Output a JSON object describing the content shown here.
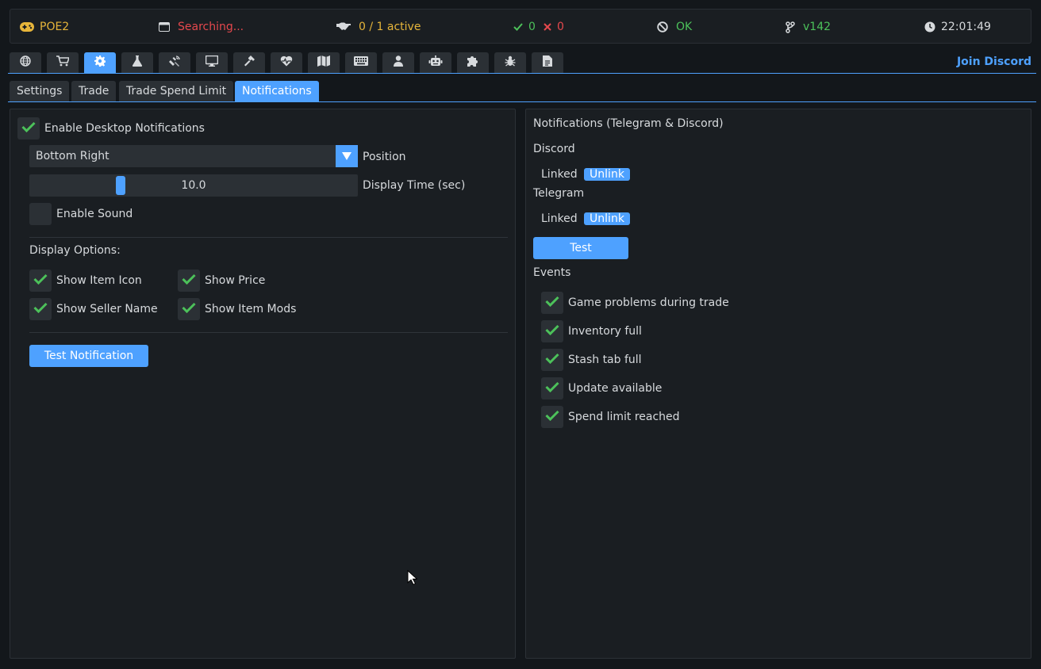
{
  "status": {
    "game": "POE2",
    "search_status": "Searching...",
    "active": "0 / 1 active",
    "success_count": "0",
    "fail_count": "0",
    "connection": "OK",
    "version": "v142",
    "clock": "22:01:49"
  },
  "toolbar": {
    "icons": [
      "globe-icon",
      "cart-icon",
      "gear-icon",
      "flask-icon",
      "satellite-icon",
      "monitor-icon",
      "hammer-icon",
      "heartbeat-icon",
      "map-icon",
      "keyboard-icon",
      "user-icon",
      "robot-icon",
      "puzzle-icon",
      "bug-icon",
      "document-icon"
    ],
    "active_index": 2,
    "join_discord": "Join Discord"
  },
  "subtabs": [
    "Settings",
    "Trade",
    "Trade Spend Limit",
    "Notifications"
  ],
  "active_subtab": "Notifications",
  "desktop": {
    "enable_label": "Enable Desktop Notifications",
    "enabled": true,
    "position_value": "Bottom Right",
    "position_label": "Position",
    "display_time_value": "10.0",
    "display_time_label": "Display Time (sec)",
    "display_time_fraction": 0.27,
    "enable_sound_label": "Enable Sound",
    "sound_enabled": false,
    "display_options_heading": "Display Options:",
    "options": [
      {
        "label": "Show Item Icon",
        "checked": true
      },
      {
        "label": "Show Price",
        "checked": true
      },
      {
        "label": "Show Seller Name",
        "checked": true
      },
      {
        "label": "Show Item Mods",
        "checked": true
      }
    ],
    "test_button": "Test Notification"
  },
  "remote": {
    "heading": "Notifications (Telegram & Discord)",
    "discord_label": "Discord",
    "discord_status": "Linked",
    "discord_unlink": "Unlink",
    "telegram_label": "Telegram",
    "telegram_status": "Linked",
    "telegram_unlink": "Unlink",
    "test_button": "Test",
    "events_heading": "Events",
    "events": [
      {
        "label": "Game problems during trade",
        "checked": true
      },
      {
        "label": "Inventory full",
        "checked": true
      },
      {
        "label": "Stash tab full",
        "checked": true
      },
      {
        "label": "Update available",
        "checked": true
      },
      {
        "label": "Spend limit reached",
        "checked": true
      }
    ]
  },
  "colors": {
    "accent": "#4ea1ff",
    "success": "#4cc15a",
    "error": "#e5484d",
    "warning": "#e6b53a"
  }
}
